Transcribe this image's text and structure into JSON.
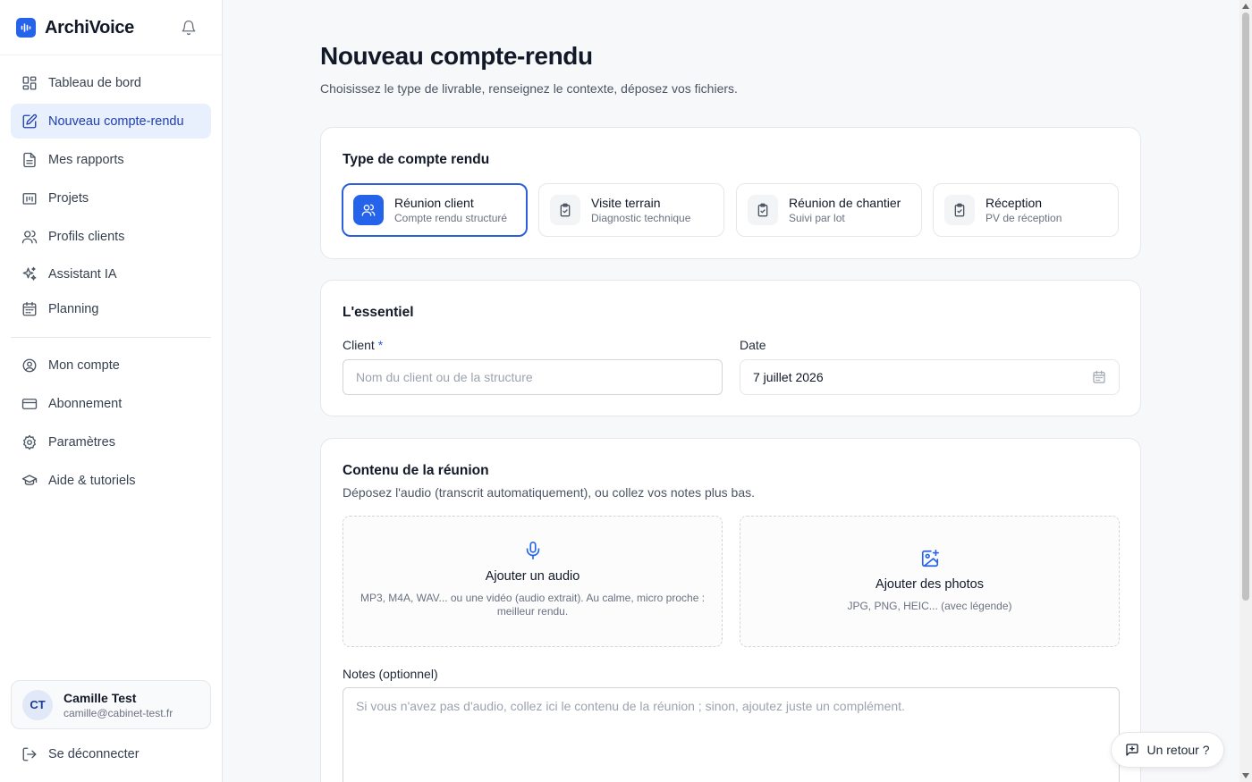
{
  "app": {
    "name": "ArchiVoice",
    "accent": "#2563eb"
  },
  "sidebar": {
    "items": [
      {
        "label": "Tableau de bord",
        "icon": "dashboard-icon",
        "active": false
      },
      {
        "label": "Nouveau compte-rendu",
        "icon": "edit-icon",
        "active": true
      },
      {
        "label": "Mes rapports",
        "icon": "document-icon",
        "active": false
      },
      {
        "label": "Projets",
        "icon": "projects-icon",
        "active": false
      },
      {
        "label": "Profils clients",
        "icon": "users-icon",
        "active": false
      },
      {
        "label": "Assistant IA",
        "icon": "sparkles-icon",
        "active": false
      },
      {
        "label": "Planning",
        "icon": "calendar-icon",
        "active": false
      }
    ],
    "secondary": [
      {
        "label": "Mon compte",
        "icon": "user-circle-icon"
      },
      {
        "label": "Abonnement",
        "icon": "credit-card-icon"
      },
      {
        "label": "Paramètres",
        "icon": "gear-icon"
      },
      {
        "label": "Aide & tutoriels",
        "icon": "graduation-cap-icon"
      }
    ],
    "user": {
      "initials": "CT",
      "name": "Camille Test",
      "email": "camille@cabinet-test.fr"
    },
    "logout": "Se déconnecter"
  },
  "page": {
    "title": "Nouveau compte-rendu",
    "subtitle": "Choisissez le type de livrable, renseignez le contexte, déposez vos fichiers."
  },
  "type_section": {
    "title": "Type de compte rendu",
    "options": [
      {
        "label": "Réunion client",
        "desc": "Compte rendu structuré",
        "icon": "users-icon",
        "selected": true
      },
      {
        "label": "Visite terrain",
        "desc": "Diagnostic technique",
        "icon": "clipboard-check-icon",
        "selected": false
      },
      {
        "label": "Réunion de chantier",
        "desc": "Suivi par lot",
        "icon": "clipboard-check-icon",
        "selected": false
      },
      {
        "label": "Réception",
        "desc": "PV de réception",
        "icon": "clipboard-check-icon",
        "selected": false
      }
    ]
  },
  "essentials": {
    "title": "L'essentiel",
    "client_label": "Client",
    "required_mark": "*",
    "client_placeholder": "Nom du client ou de la structure",
    "client_value": "",
    "date_label": "Date",
    "date_value": "7 juillet 2026"
  },
  "content": {
    "title": "Contenu de la réunion",
    "subtitle": "Déposez l'audio (transcrit automatiquement), ou collez vos notes plus bas.",
    "audio": {
      "title": "Ajouter un audio",
      "desc": "MP3, M4A, WAV... ou une vidéo (audio extrait). Au calme, micro proche : meilleur rendu."
    },
    "photos": {
      "title": "Ajouter des photos",
      "desc": "JPG, PNG, HEIC... (avec légende)"
    },
    "notes_label": "Notes (optionnel)",
    "notes_placeholder": "Si vous n'avez pas d'audio, collez ici le contenu de la réunion ; sinon, ajoutez juste un complément."
  },
  "feedback": {
    "label": "Un retour ?"
  }
}
